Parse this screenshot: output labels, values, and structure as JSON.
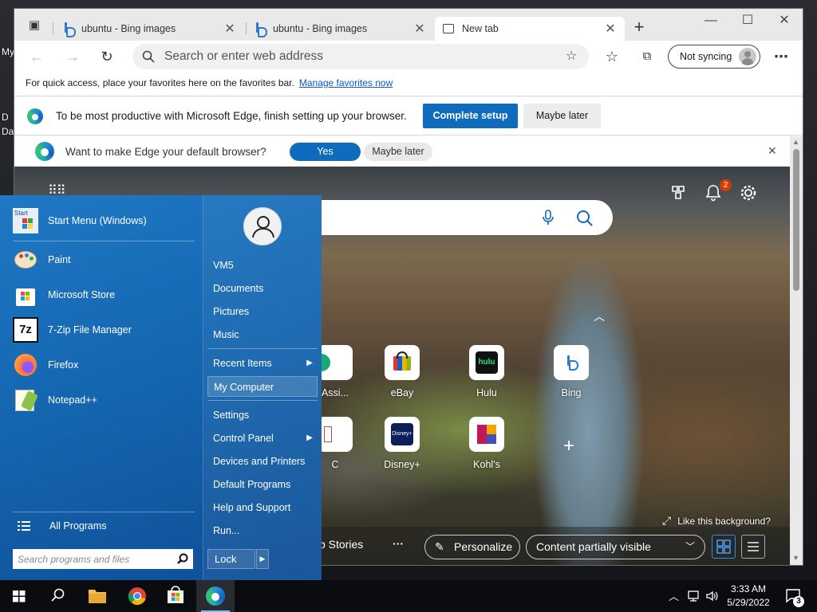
{
  "desktop": {
    "labels": [
      "My",
      "D",
      "Da"
    ]
  },
  "browser": {
    "tabs": [
      {
        "title": "ubuntu - Bing images",
        "icon": "bing-icon"
      },
      {
        "title": "ubuntu - Bing images",
        "icon": "bing-icon"
      },
      {
        "title": "New tab",
        "icon": "new-tab-page-icon",
        "active": true
      }
    ],
    "new_tab_symbol": "+",
    "window_controls": {
      "minimize": "—",
      "maximize": "☐",
      "close": "✕"
    },
    "address_bar": {
      "placeholder": "Search or enter web address",
      "value": ""
    },
    "sync_label": "Not syncing",
    "more_symbol": "⋯",
    "favorites_bar": {
      "text": "For quick access, place your favorites here on the favorites bar.",
      "link": "Manage favorites now"
    },
    "setup_banner": {
      "text": "To be most productive with Microsoft Edge, finish setting up your browser.",
      "primary": "Complete setup",
      "secondary": "Maybe later"
    },
    "default_banner": {
      "text": "Want to make Edge your default browser?",
      "yes": "Yes",
      "later": "Maybe later"
    }
  },
  "newtab": {
    "notification_count": "2",
    "tiles_row1": [
      {
        "label": "Assi...",
        "icon": "assistant-icon"
      },
      {
        "label": "eBay",
        "icon": "ebay-icon"
      },
      {
        "label": "Hulu",
        "icon": "hulu-icon",
        "icon_text": "hulu"
      },
      {
        "label": "Bing",
        "icon": "bing-icon"
      }
    ],
    "tiles_row2": [
      {
        "label": "C",
        "icon": "c-site-icon"
      },
      {
        "label": "Disney+",
        "icon": "disney-plus-icon",
        "icon_text": "Disney+"
      },
      {
        "label": "Kohl's",
        "icon": "kohls-icon"
      }
    ],
    "add_tile_symbol": "+",
    "like_background": "Like this background?",
    "bottom": {
      "stories": "p Stories",
      "more": "···",
      "personalize": "Personalize",
      "content": "Content partially visible"
    }
  },
  "start_menu": {
    "pinned": [
      {
        "label": "Start Menu (Windows)",
        "icon": "start-menu-icon",
        "icon_text": "Start"
      },
      {
        "label": "Paint",
        "icon": "paint-icon"
      },
      {
        "label": "Microsoft Store",
        "icon": "store-icon"
      },
      {
        "label": "7-Zip File Manager",
        "icon": "7zip-icon",
        "icon_text": "7z"
      },
      {
        "label": "Firefox",
        "icon": "firefox-icon"
      },
      {
        "label": "Notepad++",
        "icon": "notepadpp-icon"
      }
    ],
    "all_programs": "All Programs",
    "search_placeholder": "Search programs and files",
    "right_links": [
      {
        "label": "VM5"
      },
      {
        "label": "Documents"
      },
      {
        "label": "Pictures"
      },
      {
        "label": "Music"
      },
      {
        "label": "Recent Items",
        "arrow": "▶"
      },
      {
        "label": "My Computer"
      },
      {
        "label": "Settings"
      },
      {
        "label": "Control Panel",
        "arrow": "▶"
      },
      {
        "label": "Devices and Printers"
      },
      {
        "label": "Default Programs"
      },
      {
        "label": "Help and Support"
      },
      {
        "label": "Run..."
      }
    ],
    "lock_label": "Lock",
    "lock_arrow": "▶"
  },
  "taskbar": {
    "time": "3:33 AM",
    "date": "5/29/2022",
    "notification_count": "3",
    "apps": [
      "start-icon",
      "search-icon",
      "file-explorer-icon",
      "chrome-icon",
      "store-icon",
      "edge-icon"
    ]
  }
}
